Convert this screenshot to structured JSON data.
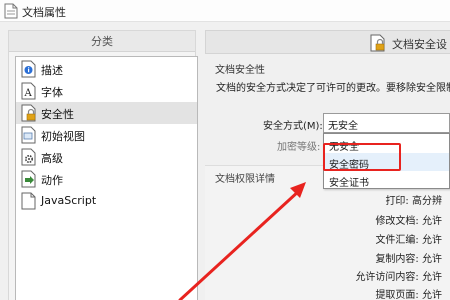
{
  "window": {
    "title": "文档属性"
  },
  "sidebar": {
    "header": "分类",
    "items": [
      {
        "label": "描述",
        "icon": "info-icon"
      },
      {
        "label": "字体",
        "icon": "font-icon"
      },
      {
        "label": "安全性",
        "icon": "security-icon",
        "selected": true
      },
      {
        "label": "初始视图",
        "icon": "initial-view-icon"
      },
      {
        "label": "高级",
        "icon": "advanced-icon"
      },
      {
        "label": "动作",
        "icon": "action-icon"
      },
      {
        "label": "JavaScript",
        "icon": "javascript-icon"
      }
    ]
  },
  "main": {
    "header_title": "文档安全设",
    "security": {
      "title": "文档安全性",
      "description": "文档的安全方式决定了可许可的更改。要移除安全限制,",
      "method_label": "安全方式(M):",
      "method_value": "无安全",
      "encryption_label": "加密等级:"
    },
    "dropdown_options": [
      "无安全",
      "安全密码",
      "安全证书"
    ],
    "permissions": {
      "title": "文档权限详情",
      "rows": [
        {
          "label": "打印:",
          "value": "高分辨"
        },
        {
          "label": "修改文档:",
          "value": "允许"
        },
        {
          "label": "文件汇编:",
          "value": "允许"
        },
        {
          "label": "复制内容:",
          "value": "允许"
        },
        {
          "label": "允许访问内容:",
          "value": "允许"
        },
        {
          "label": "提取页面:",
          "value": "允许"
        }
      ]
    }
  },
  "annotation": {
    "color": "#e8231f"
  }
}
